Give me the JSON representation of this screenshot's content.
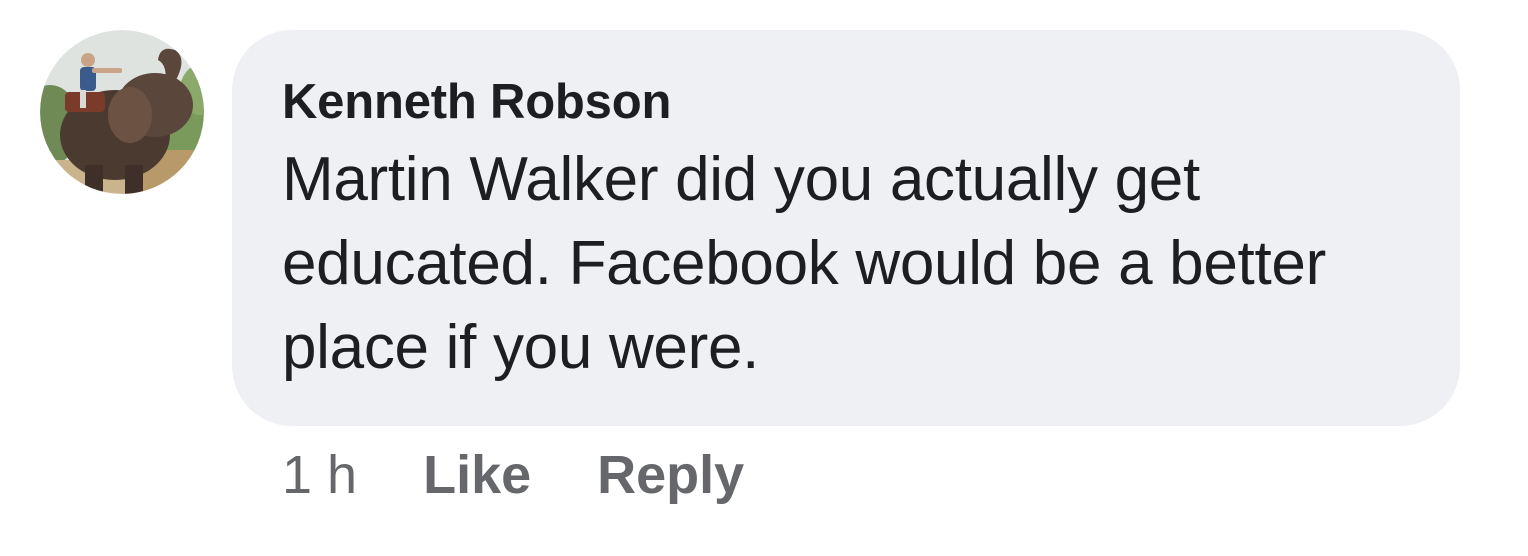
{
  "comment": {
    "author": "Kenneth Robson",
    "text": "Martin Walker did you actually get educated. Facebook would be a better place if you were.",
    "timestamp": "1 h",
    "actions": {
      "like_label": "Like",
      "reply_label": "Reply"
    }
  },
  "colors": {
    "bubble_background": "#eff0f3",
    "text_primary": "#1c1e21",
    "text_secondary": "#65676b"
  }
}
